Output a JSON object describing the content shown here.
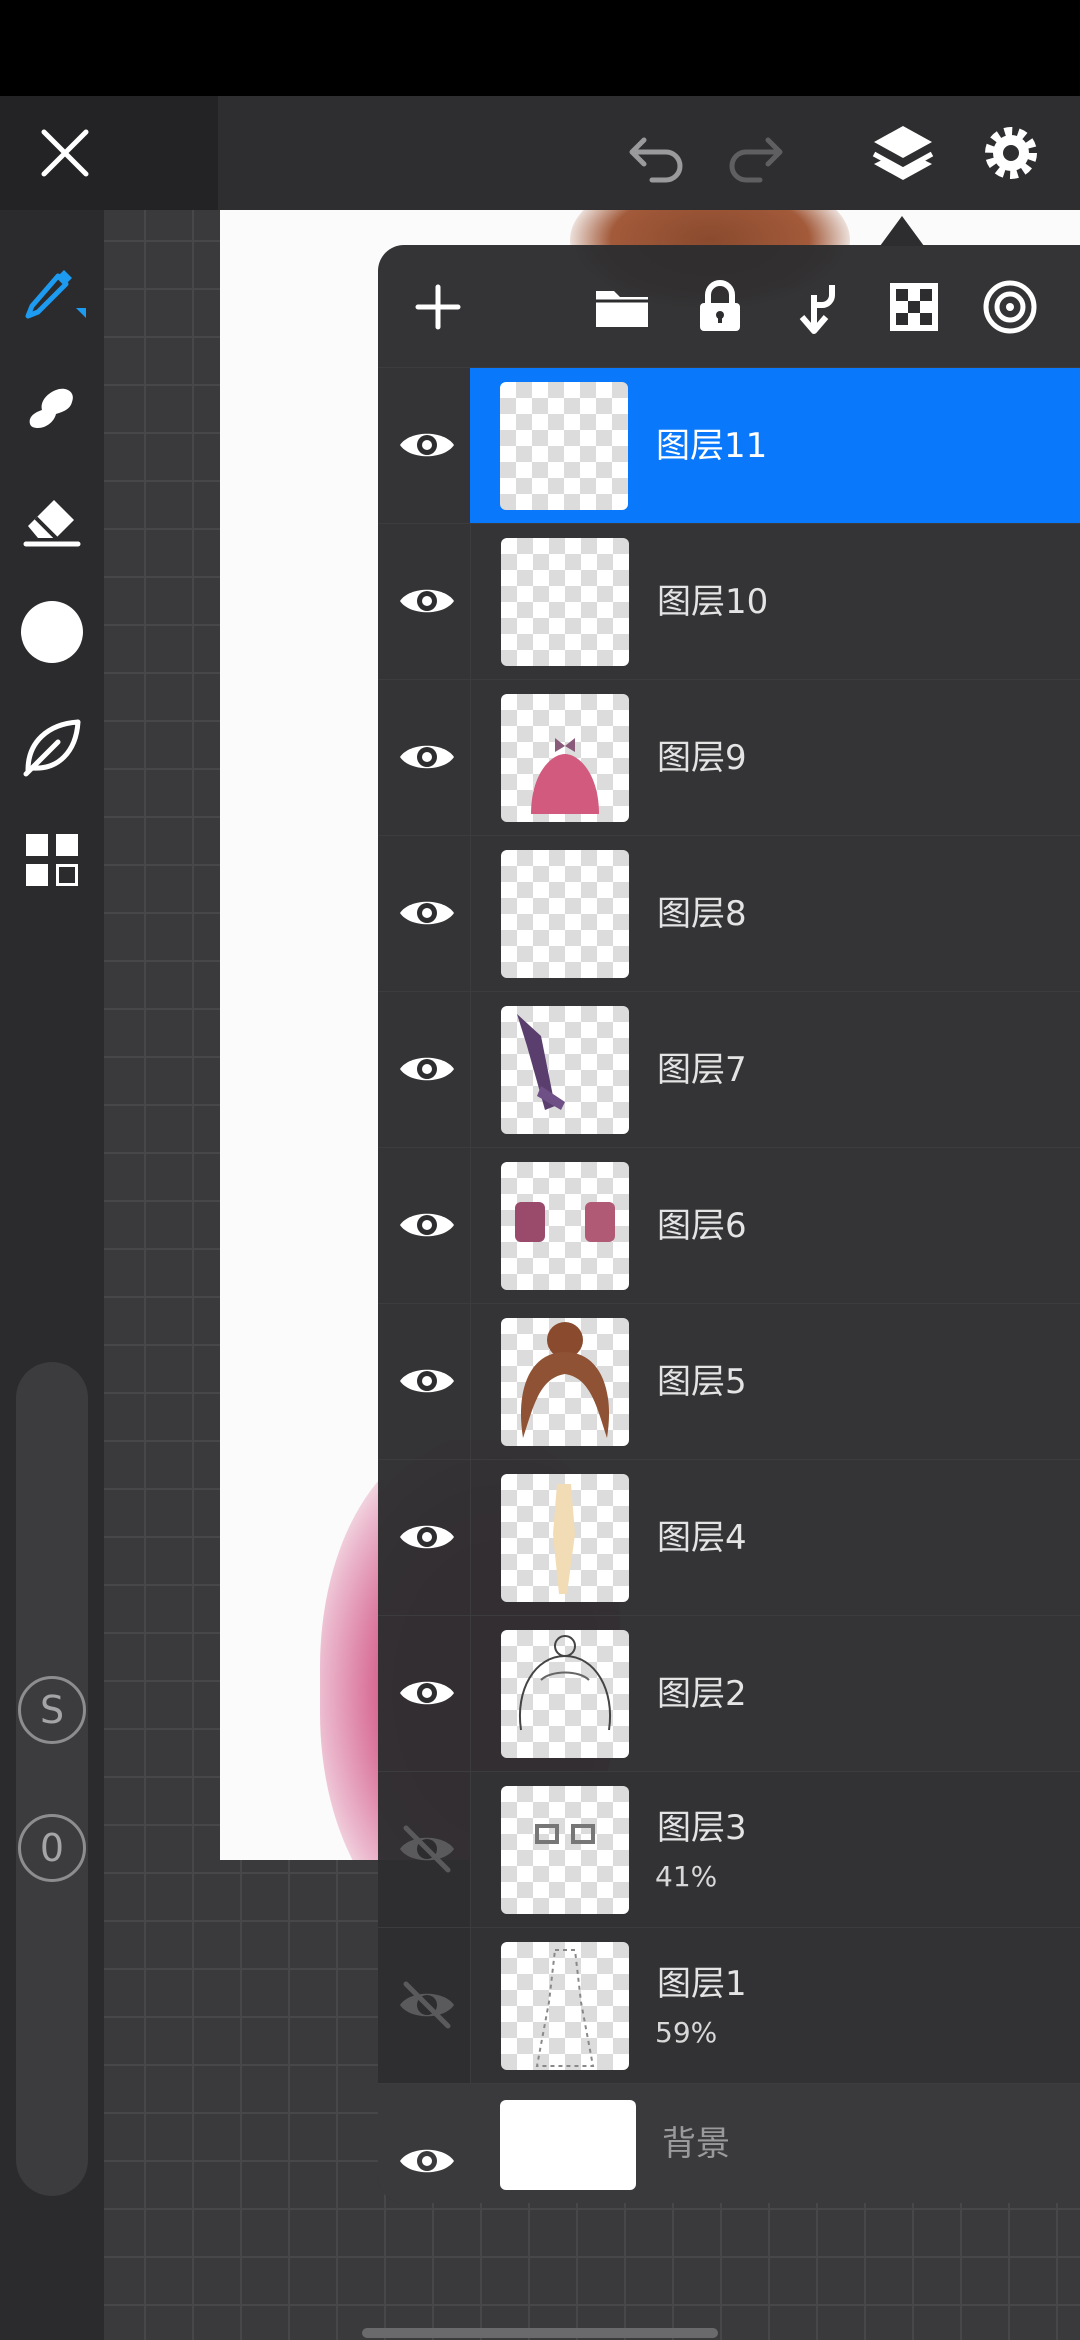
{
  "toolbar": {
    "close_icon": "close-icon",
    "undo_icon": "undo-icon",
    "redo_icon": "redo-icon",
    "layers_icon": "layers-icon",
    "settings_icon": "settings-icon"
  },
  "tools": [
    {
      "name": "brush-tool",
      "icon": "pen-icon",
      "active": true
    },
    {
      "name": "smudge-tool",
      "icon": "smudge-icon"
    },
    {
      "name": "eraser-tool",
      "icon": "eraser-icon"
    },
    {
      "name": "color-tool",
      "icon": "color-circle-icon"
    },
    {
      "name": "brush-library-tool",
      "icon": "leaf-icon"
    },
    {
      "name": "gallery-tool",
      "icon": "grid-icon"
    }
  ],
  "slider": {
    "size_label": "S",
    "opacity_label": "0"
  },
  "layers_panel": {
    "toolbar_icons": [
      "add-icon",
      "folder-icon",
      "lock-icon",
      "clip-arrow-icon",
      "checker-icon",
      "target-icon"
    ],
    "layers": [
      {
        "name": "图层11",
        "visible": true,
        "selected": true,
        "opacity": ""
      },
      {
        "name": "图层10",
        "visible": true,
        "opacity": ""
      },
      {
        "name": "图层9",
        "visible": true,
        "opacity": ""
      },
      {
        "name": "图层8",
        "visible": true,
        "opacity": ""
      },
      {
        "name": "图层7",
        "visible": true,
        "opacity": ""
      },
      {
        "name": "图层6",
        "visible": true,
        "opacity": ""
      },
      {
        "name": "图层5",
        "visible": true,
        "opacity": ""
      },
      {
        "name": "图层4",
        "visible": true,
        "opacity": ""
      },
      {
        "name": "图层2",
        "visible": true,
        "opacity": ""
      },
      {
        "name": "图层3",
        "visible": false,
        "opacity": "41%"
      },
      {
        "name": "图层1",
        "visible": false,
        "opacity": "59%"
      },
      {
        "name": "背景",
        "visible": true,
        "opacity": ""
      }
    ]
  },
  "colors": {
    "accent": "#0a78fa",
    "panel": "#2d2d2f",
    "sidebar": "#2b2b2d"
  }
}
